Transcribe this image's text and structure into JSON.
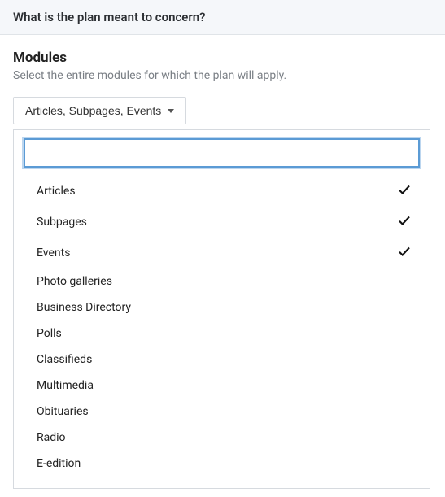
{
  "header": {
    "title": "What is the plan meant to concern?"
  },
  "section": {
    "title": "Modules",
    "description": "Select the entire modules for which the plan will apply."
  },
  "dropdown": {
    "button_label": "Articles, Subpages, Events",
    "search_value": "",
    "search_placeholder": "",
    "options": [
      {
        "label": "Articles",
        "selected": true
      },
      {
        "label": "Subpages",
        "selected": true
      },
      {
        "label": "Events",
        "selected": true
      },
      {
        "label": "Photo galleries",
        "selected": false
      },
      {
        "label": "Business Directory",
        "selected": false
      },
      {
        "label": "Polls",
        "selected": false
      },
      {
        "label": "Classifieds",
        "selected": false
      },
      {
        "label": "Multimedia",
        "selected": false
      },
      {
        "label": "Obituaries",
        "selected": false
      },
      {
        "label": "Radio",
        "selected": false
      },
      {
        "label": "E-edition",
        "selected": false
      }
    ]
  }
}
